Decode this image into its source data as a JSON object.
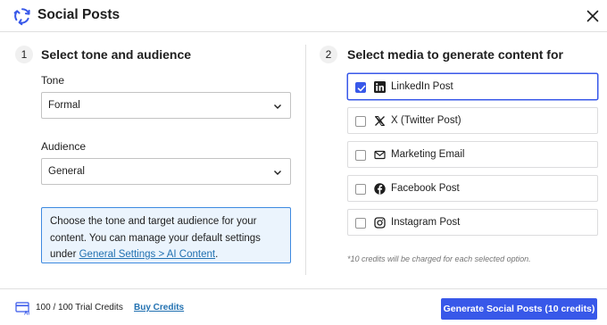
{
  "dialog": {
    "title": "Social Posts",
    "logo_icon": "circular-arrows-logo",
    "close_icon": "close-icon"
  },
  "left": {
    "number": "1",
    "title": "Select tone and audience",
    "tone": {
      "label": "Tone",
      "value": "Formal"
    },
    "audience": {
      "label": "Audience",
      "value": "General"
    },
    "info": {
      "text": "Choose the tone and target audience for your content. You can manage your default settings under ",
      "link": "General Settings > AI Content",
      "suffix": "."
    }
  },
  "right": {
    "number": "2",
    "title": "Select media to generate content for",
    "options": [
      {
        "label": "LinkedIn Post",
        "icon": "linkedin-icon",
        "checked": true
      },
      {
        "label": "X (Twitter Post)",
        "icon": "x-icon",
        "checked": false
      },
      {
        "label": "Marketing Email",
        "icon": "mail-icon",
        "checked": false
      },
      {
        "label": "Facebook Post",
        "icon": "facebook-icon",
        "checked": false
      },
      {
        "label": "Instagram Post",
        "icon": "instagram-icon",
        "checked": false
      }
    ],
    "note": "*10 credits will be charged for each selected option."
  },
  "footer": {
    "credits": "100 / 100 Trial Credits",
    "buy": "Buy Credits",
    "generate": "Generate Social Posts (10 credits)"
  },
  "colors": {
    "accent": "#3858e9",
    "link": "#2271b1",
    "info_bg": "#ebf4fd"
  }
}
